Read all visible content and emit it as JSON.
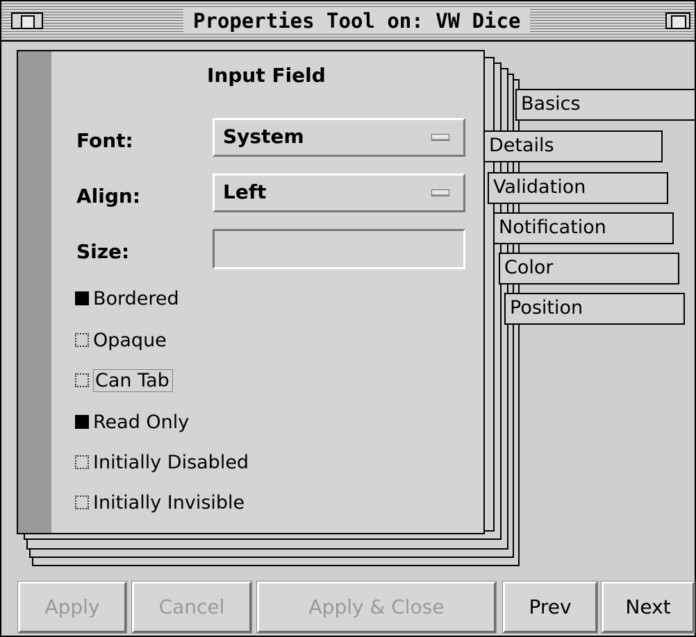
{
  "window": {
    "title": "Properties Tool on: VW Dice"
  },
  "card": {
    "heading": "Input Field"
  },
  "fields": {
    "font_label": "Font:",
    "font_value": "System",
    "align_label": "Align:",
    "align_value": "Left",
    "size_label": "Size:",
    "size_value": ""
  },
  "checkboxes": [
    {
      "label": "Bordered",
      "checked": true
    },
    {
      "label": "Opaque",
      "checked": false
    },
    {
      "label": "Can Tab",
      "checked": false
    },
    {
      "label": "Read Only",
      "checked": true
    },
    {
      "label": "Initially Disabled",
      "checked": false
    },
    {
      "label": "Initially Invisible",
      "checked": false
    }
  ],
  "tabs": [
    "Basics",
    "Details",
    "Validation",
    "Notification",
    "Color",
    "Position"
  ],
  "buttons": {
    "apply": "Apply",
    "cancel": "Cancel",
    "apply_close": "Apply & Close",
    "prev": "Prev",
    "next": "Next"
  }
}
